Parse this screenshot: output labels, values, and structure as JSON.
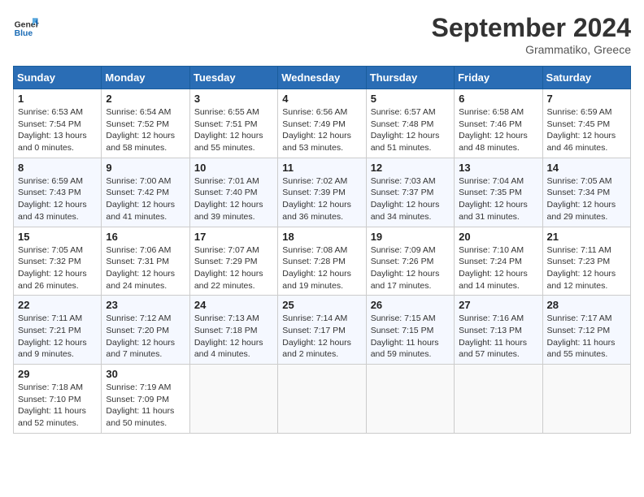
{
  "header": {
    "logo_general": "General",
    "logo_blue": "Blue",
    "month_title": "September 2024",
    "location": "Grammatiko, Greece"
  },
  "weekdays": [
    "Sunday",
    "Monday",
    "Tuesday",
    "Wednesday",
    "Thursday",
    "Friday",
    "Saturday"
  ],
  "weeks": [
    [
      {
        "day": "1",
        "sunrise": "Sunrise: 6:53 AM",
        "sunset": "Sunset: 7:54 PM",
        "daylight": "Daylight: 13 hours and 0 minutes."
      },
      {
        "day": "2",
        "sunrise": "Sunrise: 6:54 AM",
        "sunset": "Sunset: 7:52 PM",
        "daylight": "Daylight: 12 hours and 58 minutes."
      },
      {
        "day": "3",
        "sunrise": "Sunrise: 6:55 AM",
        "sunset": "Sunset: 7:51 PM",
        "daylight": "Daylight: 12 hours and 55 minutes."
      },
      {
        "day": "4",
        "sunrise": "Sunrise: 6:56 AM",
        "sunset": "Sunset: 7:49 PM",
        "daylight": "Daylight: 12 hours and 53 minutes."
      },
      {
        "day": "5",
        "sunrise": "Sunrise: 6:57 AM",
        "sunset": "Sunset: 7:48 PM",
        "daylight": "Daylight: 12 hours and 51 minutes."
      },
      {
        "day": "6",
        "sunrise": "Sunrise: 6:58 AM",
        "sunset": "Sunset: 7:46 PM",
        "daylight": "Daylight: 12 hours and 48 minutes."
      },
      {
        "day": "7",
        "sunrise": "Sunrise: 6:59 AM",
        "sunset": "Sunset: 7:45 PM",
        "daylight": "Daylight: 12 hours and 46 minutes."
      }
    ],
    [
      {
        "day": "8",
        "sunrise": "Sunrise: 6:59 AM",
        "sunset": "Sunset: 7:43 PM",
        "daylight": "Daylight: 12 hours and 43 minutes."
      },
      {
        "day": "9",
        "sunrise": "Sunrise: 7:00 AM",
        "sunset": "Sunset: 7:42 PM",
        "daylight": "Daylight: 12 hours and 41 minutes."
      },
      {
        "day": "10",
        "sunrise": "Sunrise: 7:01 AM",
        "sunset": "Sunset: 7:40 PM",
        "daylight": "Daylight: 12 hours and 39 minutes."
      },
      {
        "day": "11",
        "sunrise": "Sunrise: 7:02 AM",
        "sunset": "Sunset: 7:39 PM",
        "daylight": "Daylight: 12 hours and 36 minutes."
      },
      {
        "day": "12",
        "sunrise": "Sunrise: 7:03 AM",
        "sunset": "Sunset: 7:37 PM",
        "daylight": "Daylight: 12 hours and 34 minutes."
      },
      {
        "day": "13",
        "sunrise": "Sunrise: 7:04 AM",
        "sunset": "Sunset: 7:35 PM",
        "daylight": "Daylight: 12 hours and 31 minutes."
      },
      {
        "day": "14",
        "sunrise": "Sunrise: 7:05 AM",
        "sunset": "Sunset: 7:34 PM",
        "daylight": "Daylight: 12 hours and 29 minutes."
      }
    ],
    [
      {
        "day": "15",
        "sunrise": "Sunrise: 7:05 AM",
        "sunset": "Sunset: 7:32 PM",
        "daylight": "Daylight: 12 hours and 26 minutes."
      },
      {
        "day": "16",
        "sunrise": "Sunrise: 7:06 AM",
        "sunset": "Sunset: 7:31 PM",
        "daylight": "Daylight: 12 hours and 24 minutes."
      },
      {
        "day": "17",
        "sunrise": "Sunrise: 7:07 AM",
        "sunset": "Sunset: 7:29 PM",
        "daylight": "Daylight: 12 hours and 22 minutes."
      },
      {
        "day": "18",
        "sunrise": "Sunrise: 7:08 AM",
        "sunset": "Sunset: 7:28 PM",
        "daylight": "Daylight: 12 hours and 19 minutes."
      },
      {
        "day": "19",
        "sunrise": "Sunrise: 7:09 AM",
        "sunset": "Sunset: 7:26 PM",
        "daylight": "Daylight: 12 hours and 17 minutes."
      },
      {
        "day": "20",
        "sunrise": "Sunrise: 7:10 AM",
        "sunset": "Sunset: 7:24 PM",
        "daylight": "Daylight: 12 hours and 14 minutes."
      },
      {
        "day": "21",
        "sunrise": "Sunrise: 7:11 AM",
        "sunset": "Sunset: 7:23 PM",
        "daylight": "Daylight: 12 hours and 12 minutes."
      }
    ],
    [
      {
        "day": "22",
        "sunrise": "Sunrise: 7:11 AM",
        "sunset": "Sunset: 7:21 PM",
        "daylight": "Daylight: 12 hours and 9 minutes."
      },
      {
        "day": "23",
        "sunrise": "Sunrise: 7:12 AM",
        "sunset": "Sunset: 7:20 PM",
        "daylight": "Daylight: 12 hours and 7 minutes."
      },
      {
        "day": "24",
        "sunrise": "Sunrise: 7:13 AM",
        "sunset": "Sunset: 7:18 PM",
        "daylight": "Daylight: 12 hours and 4 minutes."
      },
      {
        "day": "25",
        "sunrise": "Sunrise: 7:14 AM",
        "sunset": "Sunset: 7:17 PM",
        "daylight": "Daylight: 12 hours and 2 minutes."
      },
      {
        "day": "26",
        "sunrise": "Sunrise: 7:15 AM",
        "sunset": "Sunset: 7:15 PM",
        "daylight": "Daylight: 11 hours and 59 minutes."
      },
      {
        "day": "27",
        "sunrise": "Sunrise: 7:16 AM",
        "sunset": "Sunset: 7:13 PM",
        "daylight": "Daylight: 11 hours and 57 minutes."
      },
      {
        "day": "28",
        "sunrise": "Sunrise: 7:17 AM",
        "sunset": "Sunset: 7:12 PM",
        "daylight": "Daylight: 11 hours and 55 minutes."
      }
    ],
    [
      {
        "day": "29",
        "sunrise": "Sunrise: 7:18 AM",
        "sunset": "Sunset: 7:10 PM",
        "daylight": "Daylight: 11 hours and 52 minutes."
      },
      {
        "day": "30",
        "sunrise": "Sunrise: 7:19 AM",
        "sunset": "Sunset: 7:09 PM",
        "daylight": "Daylight: 11 hours and 50 minutes."
      },
      null,
      null,
      null,
      null,
      null
    ]
  ]
}
